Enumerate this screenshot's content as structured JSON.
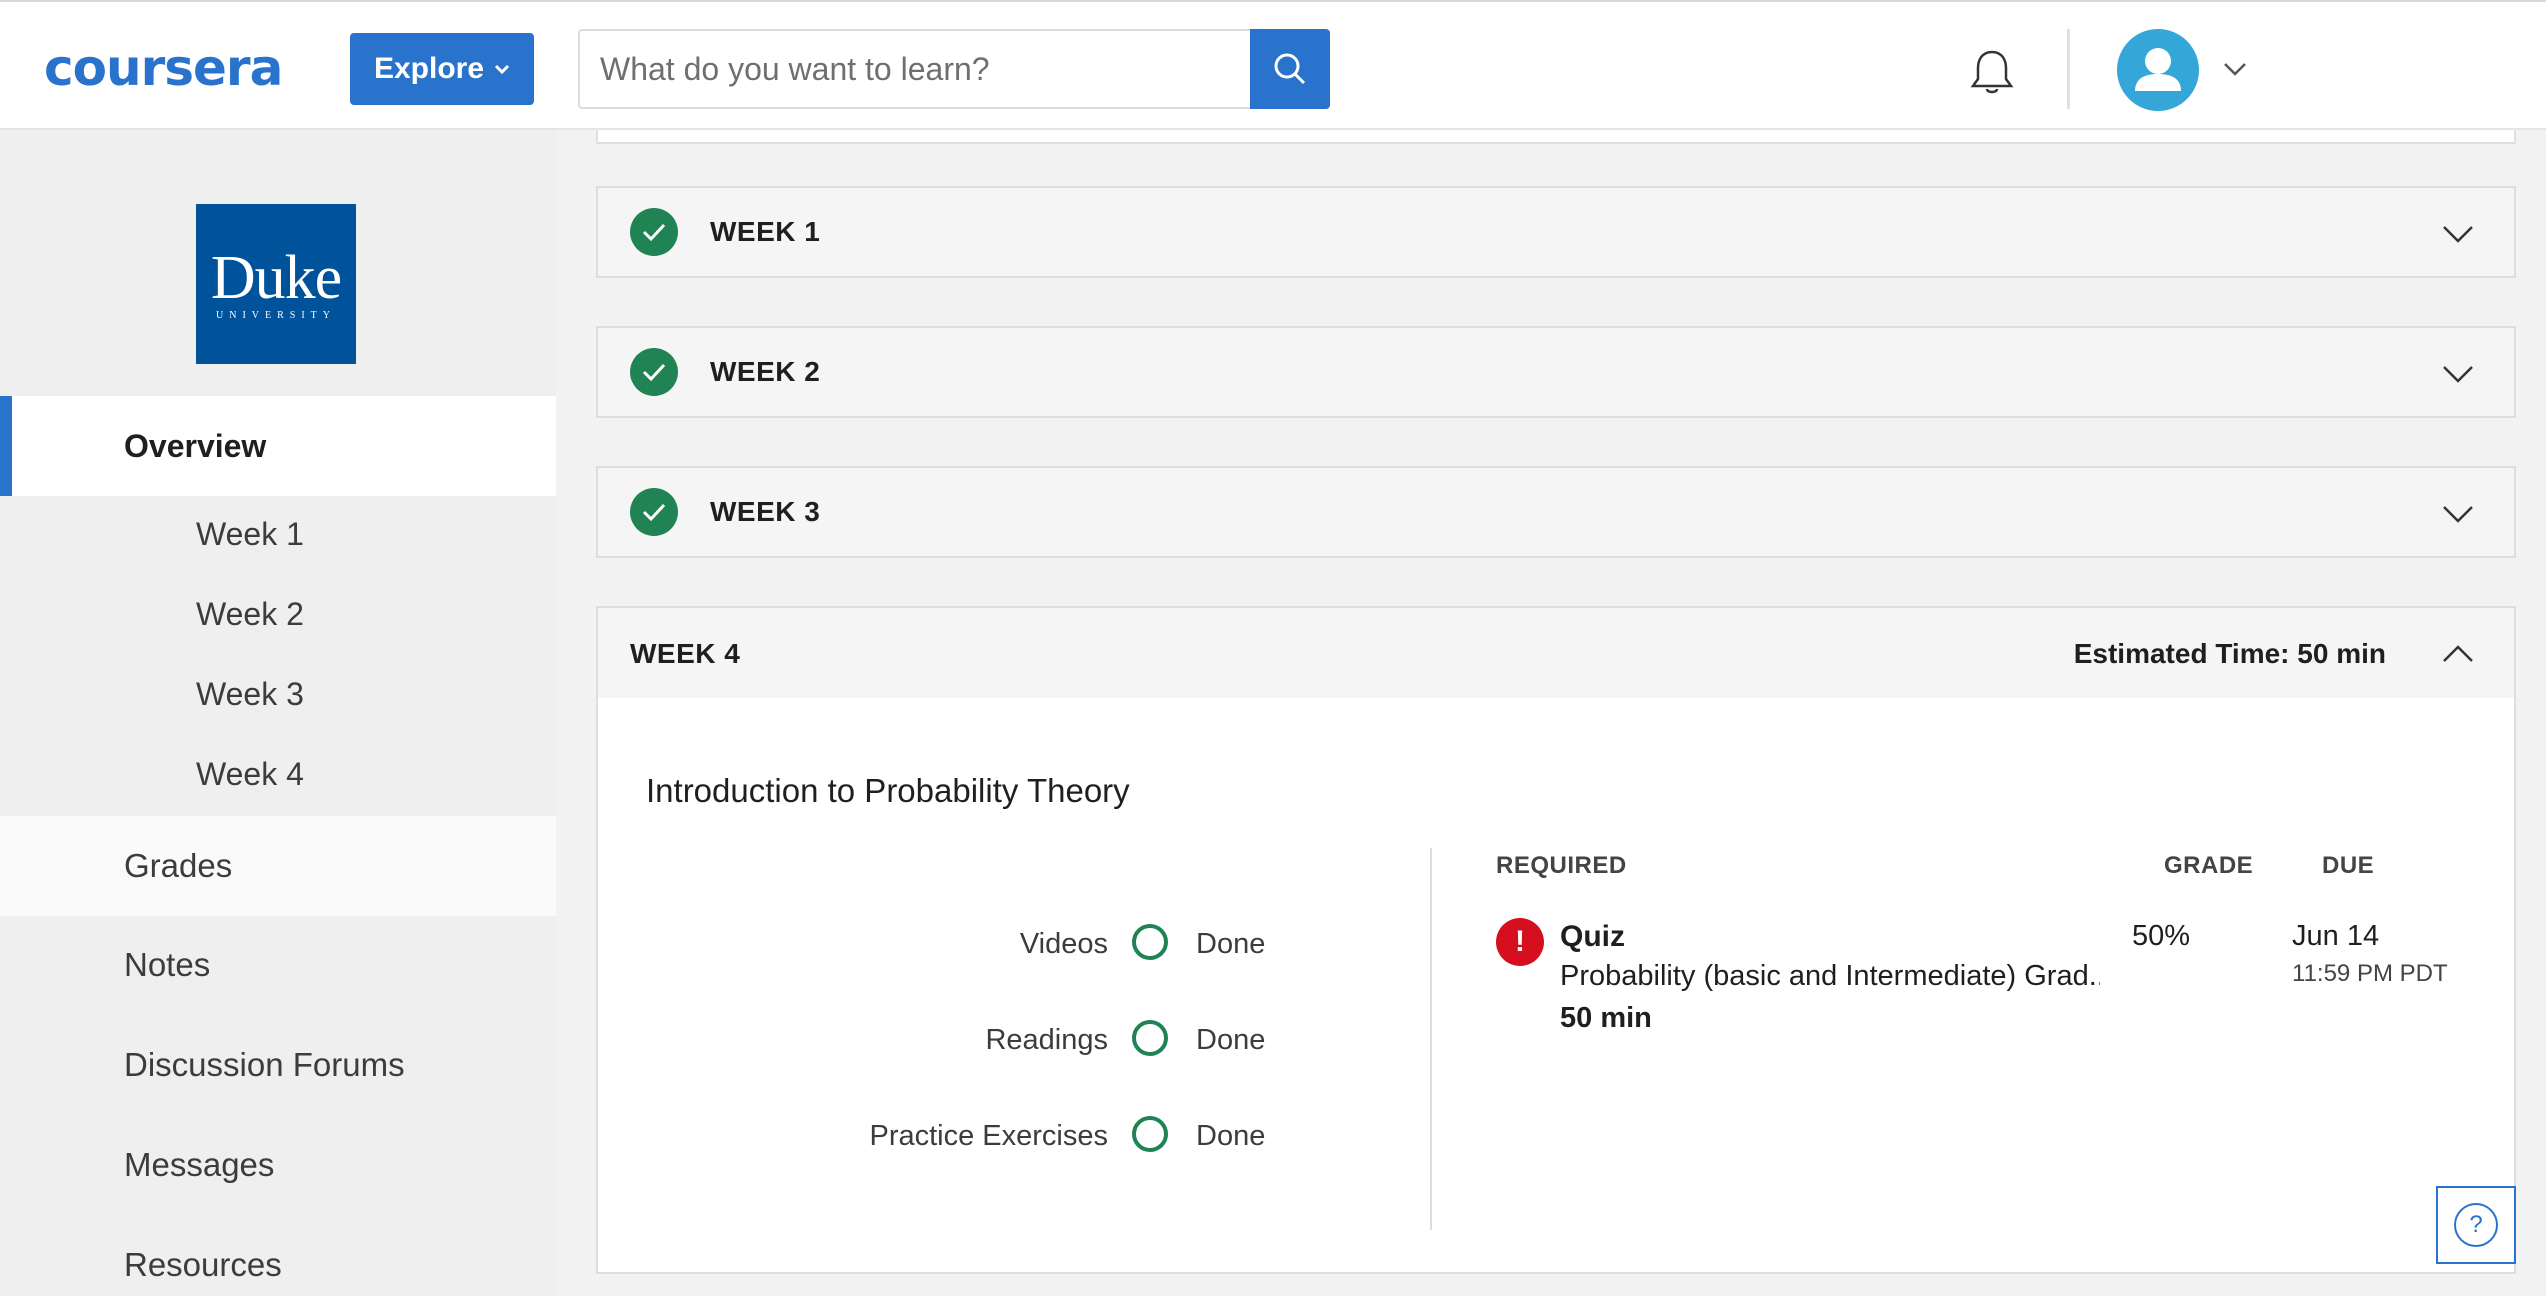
{
  "header": {
    "logo": "coursera",
    "explore_label": "Explore",
    "search_placeholder": "What do you want to learn?",
    "search_value": ""
  },
  "sidebar": {
    "school_logo": {
      "word": "Duke",
      "sub": "UNIVERSITY",
      "color": "#00539b"
    },
    "overview_label": "Overview",
    "weeks": [
      "Week 1",
      "Week 2",
      "Week 3",
      "Week 4"
    ],
    "items": [
      "Grades",
      "Notes",
      "Discussion Forums",
      "Messages",
      "Resources"
    ]
  },
  "weeks": [
    {
      "title": "WEEK 1",
      "completed": true
    },
    {
      "title": "WEEK 2",
      "completed": true
    },
    {
      "title": "WEEK 3",
      "completed": true
    }
  ],
  "week4": {
    "title": "WEEK 4",
    "estimated_time": "Estimated Time: 50 min",
    "lesson_title": "Introduction to Probability Theory",
    "progress": [
      {
        "label": "Videos",
        "status": "Done"
      },
      {
        "label": "Readings",
        "status": "Done"
      },
      {
        "label": "Practice Exercises",
        "status": "Done"
      }
    ],
    "columns": {
      "required": "REQUIRED",
      "grade": "GRADE",
      "due": "DUE"
    },
    "required_item": {
      "type": "Quiz",
      "name": "Probability (basic and Intermediate) Grad...",
      "duration": "50 min",
      "grade": "50%",
      "due_date": "Jun 14",
      "due_time": "11:59 PM PDT",
      "alert_icon": "!"
    }
  },
  "help": {
    "icon": "?"
  },
  "colors": {
    "brand": "#2a73cc",
    "success": "#1f8354",
    "alert": "#d50f1e",
    "avatar": "#34a7d8"
  }
}
